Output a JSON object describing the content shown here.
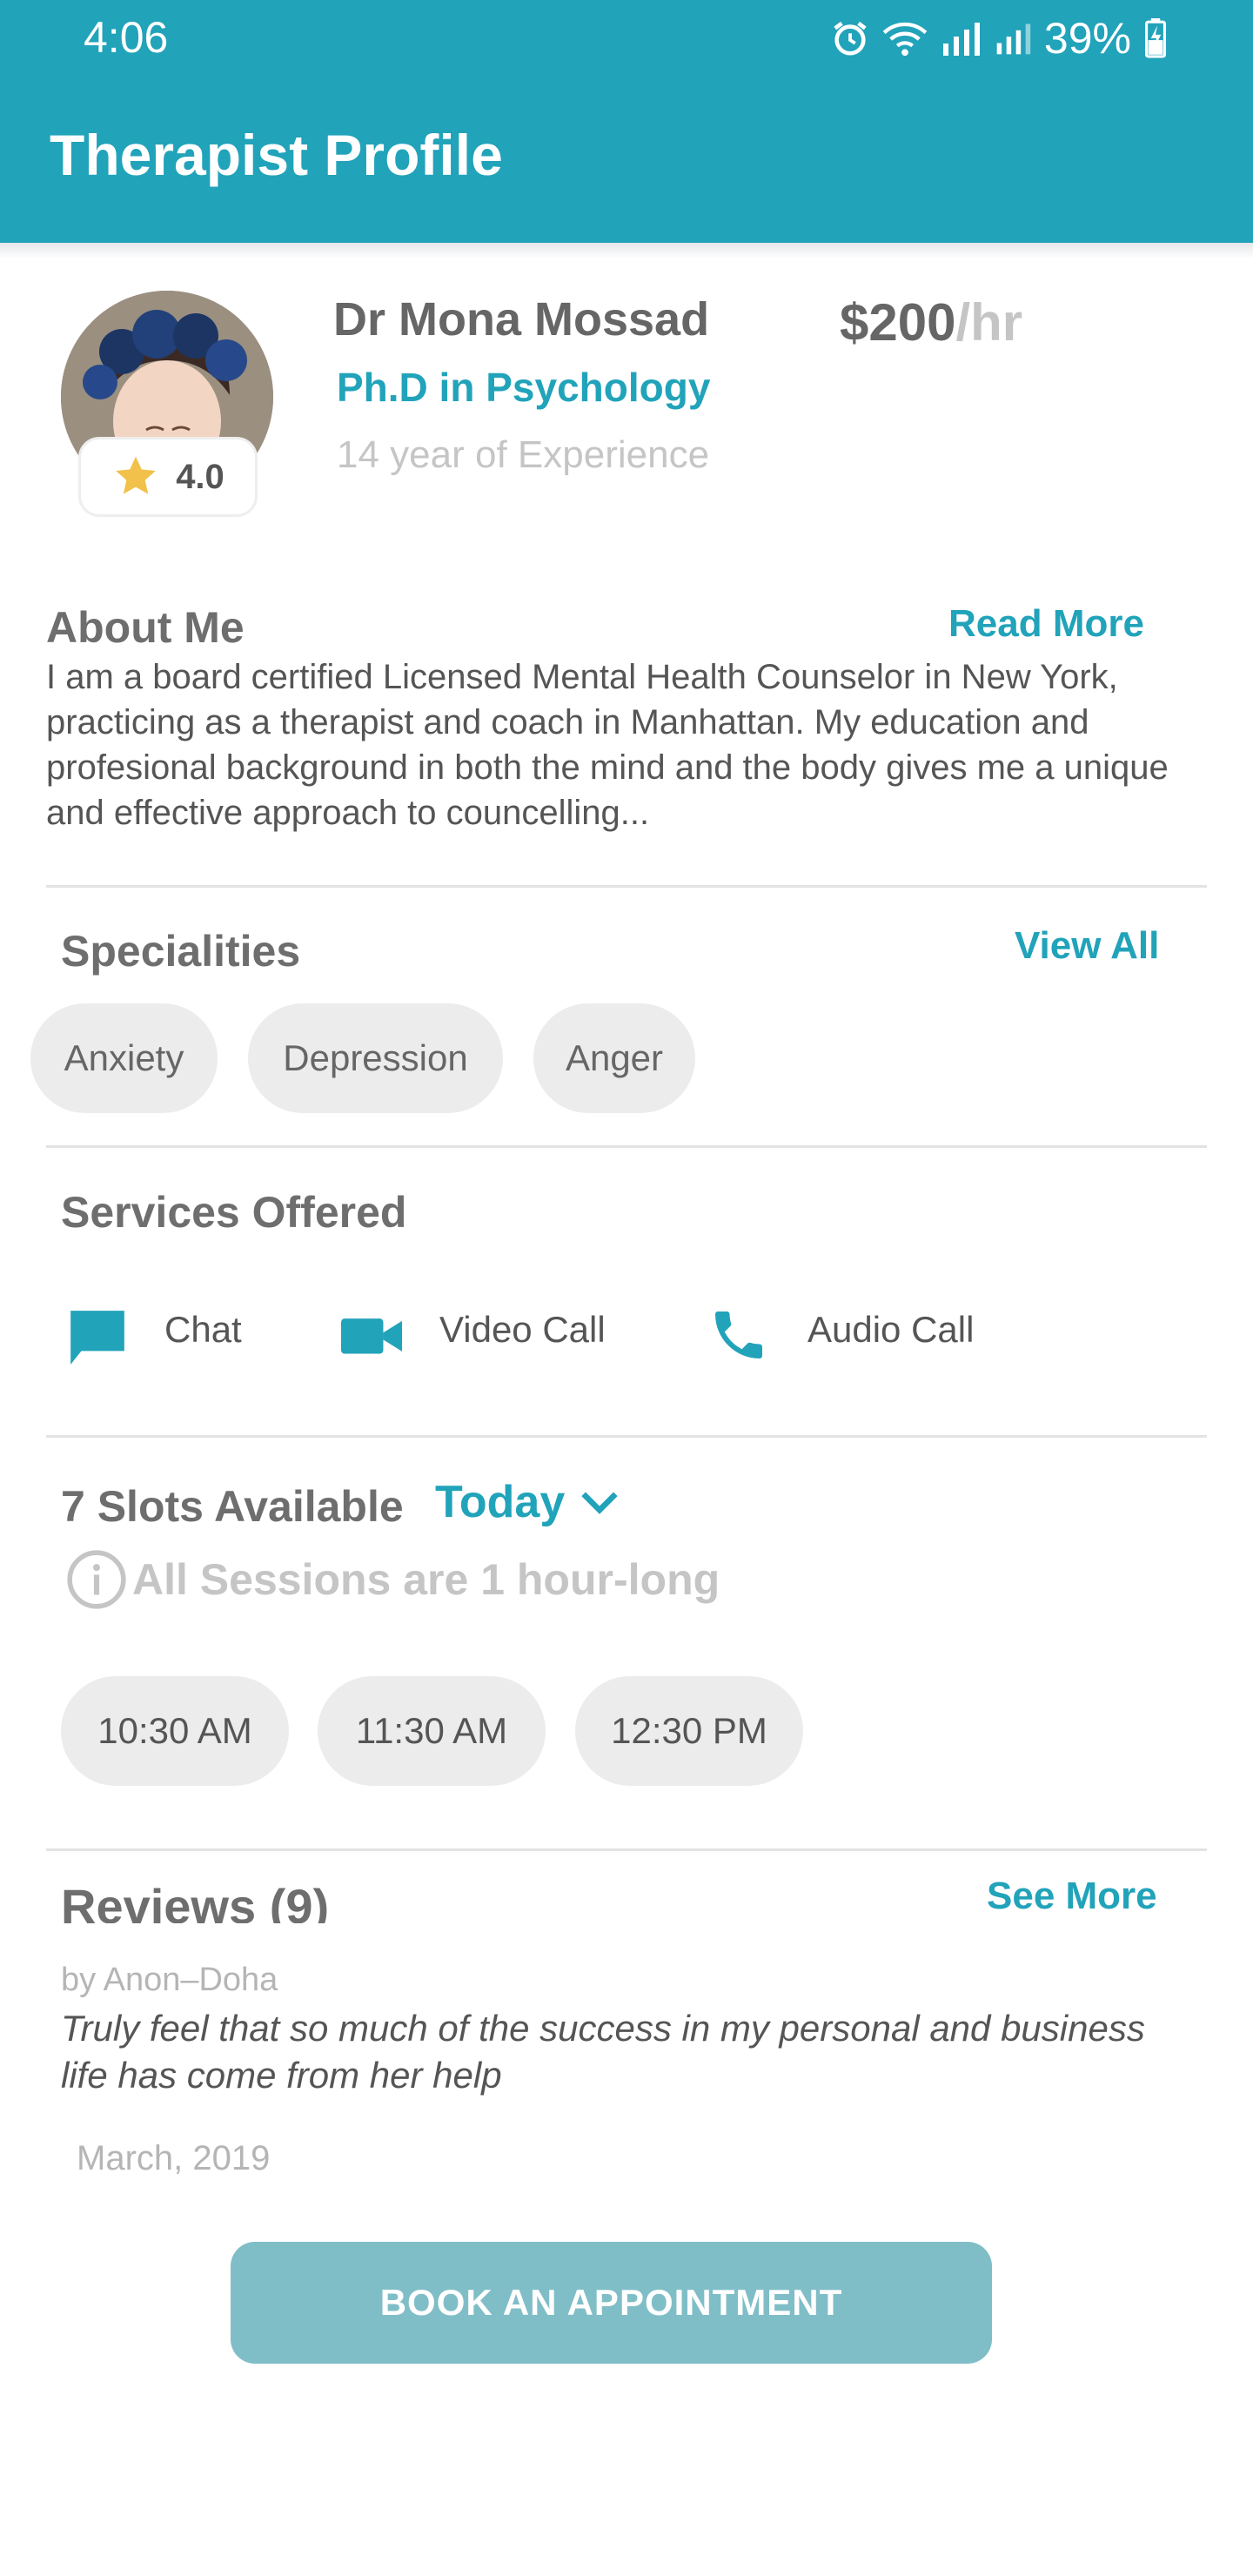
{
  "status_bar": {
    "time": "4:06",
    "battery": "39%"
  },
  "header": {
    "title": "Therapist Profile"
  },
  "profile": {
    "name": "Dr Mona Mossad",
    "degree": "Ph.D in Psychology",
    "experience": "14 year of Experience",
    "price_amount": "$200",
    "price_unit": "/hr",
    "rating": "4.0"
  },
  "about": {
    "title": "About Me",
    "read_more": "Read More",
    "text": "I am a board certified Licensed Mental Health Counselor in New York, practicing as a therapist and coach in Manhattan. My education and profesional background in both the mind and the body gives me a unique and effective approach to councelling..."
  },
  "specialities": {
    "title": "Specialities",
    "view_all": "View All",
    "items": [
      "Anxiety",
      "Depression",
      "Anger"
    ]
  },
  "services": {
    "title": "Services Offered",
    "items": [
      {
        "label": "Chat",
        "icon": "chat-icon"
      },
      {
        "label": "Video Call",
        "icon": "video-camera-icon"
      },
      {
        "label": "Audio Call",
        "icon": "phone-icon"
      }
    ]
  },
  "slots": {
    "title": "7 Slots Available",
    "day": "Today",
    "info": "All Sessions are 1 hour-long",
    "times": [
      "10:30 AM",
      "11:30 AM",
      "12:30 PM"
    ]
  },
  "reviews": {
    "title": "Reviews (9)",
    "see_more": "See More",
    "author": "by Anon–Doha",
    "text": "Truly feel that so much of the success in my personal and business life has come from her help",
    "date": "March, 2019"
  },
  "book_button": "BOOK AN APPOINTMENT",
  "colors": {
    "primary": "#21a3ba",
    "button": "#80bec7",
    "chip": "#ececec",
    "star": "#f1c14b"
  }
}
